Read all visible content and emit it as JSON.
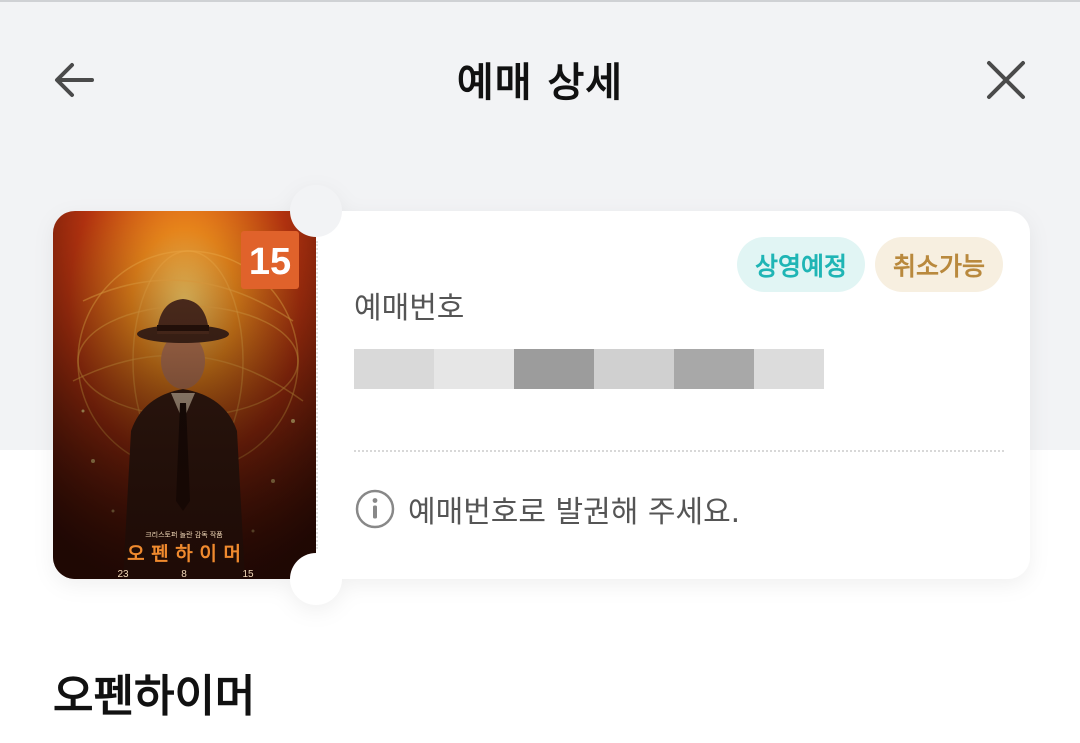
{
  "header": {
    "title": "예매 상세"
  },
  "ticket": {
    "rating": "15",
    "poster": {
      "title": "오 펜 하 이 머",
      "credit": "크리스토퍼 놀란 감독 작품",
      "date": [
        "23",
        "8",
        "15"
      ]
    },
    "badges": {
      "status": "상영예정",
      "cancel": "취소가능"
    },
    "booking_label": "예매번호",
    "notice": "예매번호로 발권해 주세요."
  },
  "movie": {
    "title": "오펜하이머"
  },
  "colors": {
    "accent_teal": "#1fb5b5",
    "accent_gold": "#b9893d",
    "rating_orange": "#e0622b"
  }
}
